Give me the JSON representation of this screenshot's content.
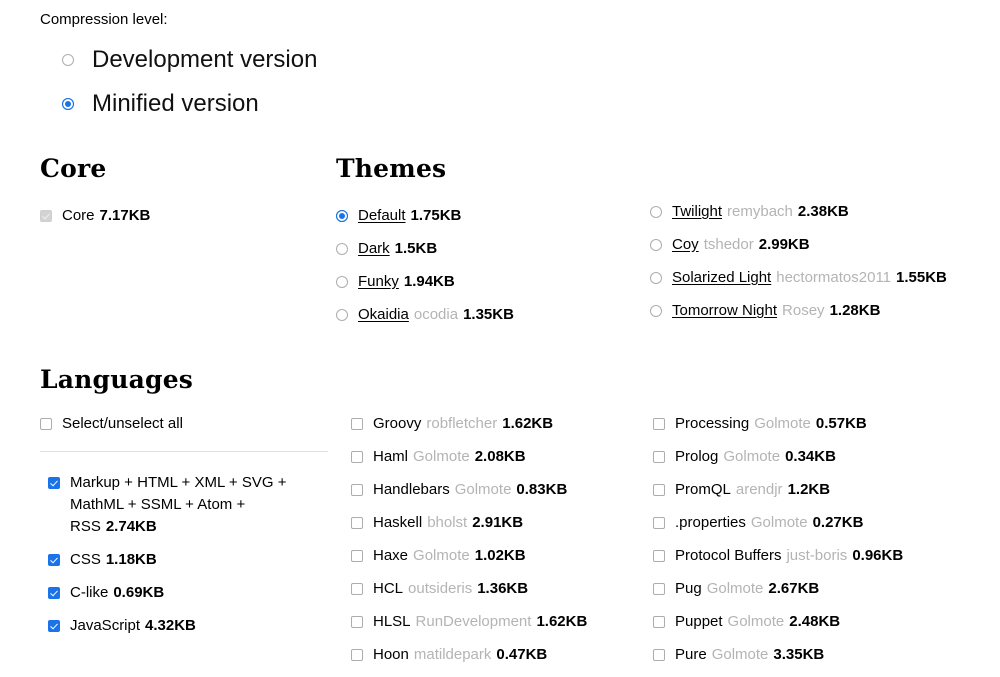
{
  "compression": {
    "label": "Compression level:",
    "options": [
      {
        "label": "Development version",
        "checked": false
      },
      {
        "label": "Minified version",
        "checked": true
      }
    ]
  },
  "core": {
    "heading": "Core",
    "items": [
      {
        "name": "Core",
        "owner": "",
        "size": "7.17KB",
        "checked": true,
        "disabled": true
      }
    ]
  },
  "themes": {
    "heading": "Themes",
    "column1": [
      {
        "name": "Default",
        "owner": "",
        "size": "1.75KB",
        "checked": true
      },
      {
        "name": "Dark",
        "owner": "",
        "size": "1.5KB",
        "checked": false
      },
      {
        "name": "Funky",
        "owner": "",
        "size": "1.94KB",
        "checked": false
      },
      {
        "name": "Okaidia",
        "owner": "ocodia",
        "size": "1.35KB",
        "checked": false
      }
    ],
    "column2": [
      {
        "name": "Twilight",
        "owner": "remybach",
        "size": "2.38KB",
        "checked": false
      },
      {
        "name": "Coy",
        "owner": "tshedor",
        "size": "2.99KB",
        "checked": false
      },
      {
        "name": "Solarized Light",
        "owner": "hectormatos2011",
        "size": "1.55KB",
        "checked": false
      },
      {
        "name": "Tomorrow Night",
        "owner": "Rosey",
        "size": "1.28KB",
        "checked": false
      }
    ]
  },
  "languages": {
    "heading": "Languages",
    "select_all": {
      "label": "Select/unselect all",
      "checked": false
    },
    "column1": [
      {
        "name": "Markup + HTML + XML + SVG + MathML + SSML + Atom + RSS",
        "owner": "",
        "size": "2.74KB",
        "checked": true
      },
      {
        "name": "CSS",
        "owner": "",
        "size": "1.18KB",
        "checked": true
      },
      {
        "name": "C-like",
        "owner": "",
        "size": "0.69KB",
        "checked": true
      },
      {
        "name": "JavaScript",
        "owner": "",
        "size": "4.32KB",
        "checked": true
      }
    ],
    "column2": [
      {
        "name": "Groovy",
        "owner": "robfletcher",
        "size": "1.62KB",
        "checked": false
      },
      {
        "name": "Haml",
        "owner": "Golmote",
        "size": "2.08KB",
        "checked": false
      },
      {
        "name": "Handlebars",
        "owner": "Golmote",
        "size": "0.83KB",
        "checked": false
      },
      {
        "name": "Haskell",
        "owner": "bholst",
        "size": "2.91KB",
        "checked": false
      },
      {
        "name": "Haxe",
        "owner": "Golmote",
        "size": "1.02KB",
        "checked": false
      },
      {
        "name": "HCL",
        "owner": "outsideris",
        "size": "1.36KB",
        "checked": false
      },
      {
        "name": "HLSL",
        "owner": "RunDevelopment",
        "size": "1.62KB",
        "checked": false
      },
      {
        "name": "Hoon",
        "owner": "matildepark",
        "size": "0.47KB",
        "checked": false
      }
    ],
    "column3": [
      {
        "name": "Processing",
        "owner": "Golmote",
        "size": "0.57KB",
        "checked": false
      },
      {
        "name": "Prolog",
        "owner": "Golmote",
        "size": "0.34KB",
        "checked": false
      },
      {
        "name": "PromQL",
        "owner": "arendjr",
        "size": "1.2KB",
        "checked": false
      },
      {
        "name": ".properties",
        "owner": "Golmote",
        "size": "0.27KB",
        "checked": false
      },
      {
        "name": "Protocol Buffers",
        "owner": "just-boris",
        "size": "0.96KB",
        "checked": false
      },
      {
        "name": "Pug",
        "owner": "Golmote",
        "size": "2.67KB",
        "checked": false
      },
      {
        "name": "Puppet",
        "owner": "Golmote",
        "size": "2.48KB",
        "checked": false
      },
      {
        "name": "Pure",
        "owner": "Golmote",
        "size": "3.35KB",
        "checked": false
      }
    ]
  },
  "colors": {
    "accent": "#1a73e8",
    "owner_text": "#b4b4b4",
    "divider": "#e0e0e0"
  }
}
